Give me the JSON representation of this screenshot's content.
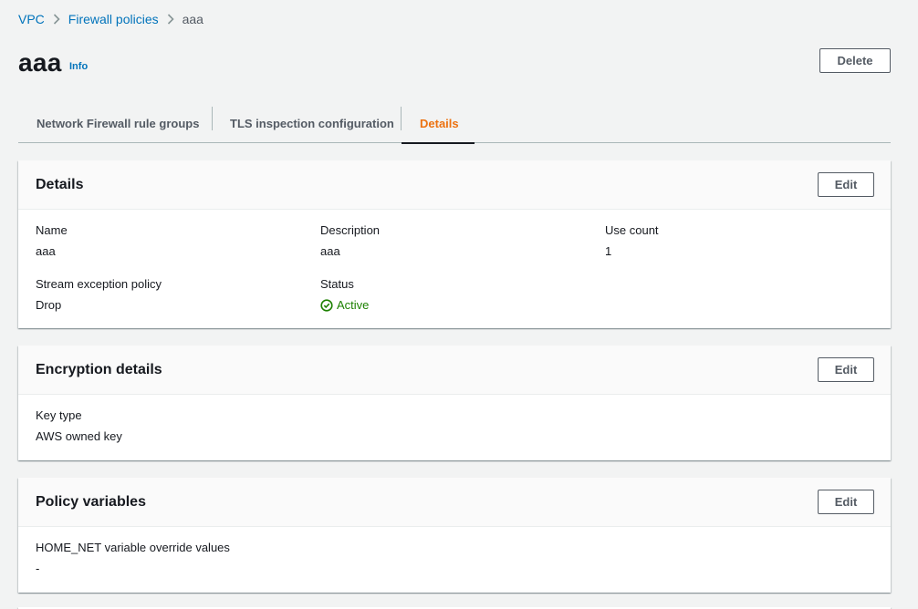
{
  "breadcrumb": {
    "items": [
      "VPC",
      "Firewall policies"
    ],
    "current": "aaa"
  },
  "header": {
    "title": "aaa",
    "info_label": "Info",
    "delete_label": "Delete"
  },
  "tabs": [
    {
      "label": "Network Firewall rule groups",
      "active": false
    },
    {
      "label": "TLS inspection configuration",
      "active": false
    },
    {
      "label": "Details",
      "active": true
    }
  ],
  "details": {
    "title": "Details",
    "edit_label": "Edit",
    "name_label": "Name",
    "name_value": "aaa",
    "description_label": "Description",
    "description_value": "aaa",
    "use_count_label": "Use count",
    "use_count_value": "1",
    "stream_label": "Stream exception policy",
    "stream_value": "Drop",
    "status_label": "Status",
    "status_value": "Active"
  },
  "encryption": {
    "title": "Encryption details",
    "edit_label": "Edit",
    "key_type_label": "Key type",
    "key_type_value": "AWS owned key"
  },
  "policy_variables": {
    "title": "Policy variables",
    "edit_label": "Edit",
    "home_net_label": "HOME_NET variable override values",
    "home_net_value": "-"
  },
  "colors": {
    "link": "#0073bb",
    "active_tab": "#ec7211",
    "status_success": "#1d8102",
    "background": "#f2f3f3"
  },
  "icons": [
    "chevron-right-icon",
    "status-success-icon"
  ]
}
